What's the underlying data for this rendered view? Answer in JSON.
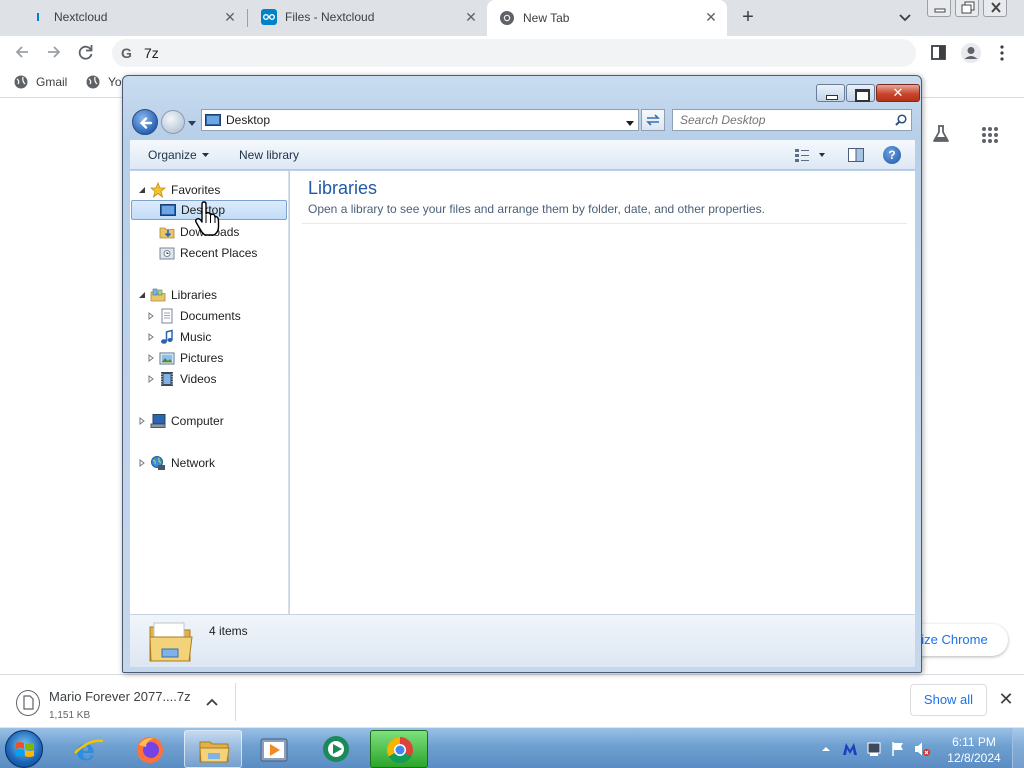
{
  "browser": {
    "tabs": [
      {
        "title": "Nextcloud",
        "active": false
      },
      {
        "title": "Files - Nextcloud",
        "active": false
      },
      {
        "title": "New Tab",
        "active": true
      }
    ],
    "omnibox_text": "7z",
    "bookmarks": [
      {
        "label": "Gmail"
      },
      {
        "label": "Yo"
      }
    ],
    "customize_label": "nize Chrome",
    "accent_color": "#1a73e8"
  },
  "download_bar": {
    "file_name": "Mario Forever 2077....7z",
    "file_size": "1,151 KB",
    "show_all_label": "Show all"
  },
  "explorer": {
    "address": "Desktop",
    "search_placeholder": "Search Desktop",
    "commands": {
      "organize": "Organize",
      "new_library": "New library"
    },
    "nav": {
      "favorites": {
        "label": "Favorites",
        "items": [
          "Desktop",
          "Downloads",
          "Recent Places"
        ]
      },
      "libraries": {
        "label": "Libraries",
        "items": [
          "Documents",
          "Music",
          "Pictures",
          "Videos"
        ]
      },
      "computer": "Computer",
      "network": "Network"
    },
    "selected_nav_item": "Desktop",
    "content": {
      "title": "Libraries",
      "description": "Open a library to see your files and arrange them by folder, date, and other properties."
    },
    "details": {
      "item_count": "4 items"
    }
  },
  "taskbar": {
    "pinned": [
      {
        "icon": "internet-explorer-icon"
      },
      {
        "icon": "firefox-icon"
      },
      {
        "icon": "windows-explorer-icon",
        "open": true
      },
      {
        "icon": "media-player-icon"
      },
      {
        "icon": "app-icon"
      },
      {
        "icon": "chrome-icon",
        "active": true
      }
    ],
    "time": "6:11 PM",
    "date": "12/8/2024"
  }
}
